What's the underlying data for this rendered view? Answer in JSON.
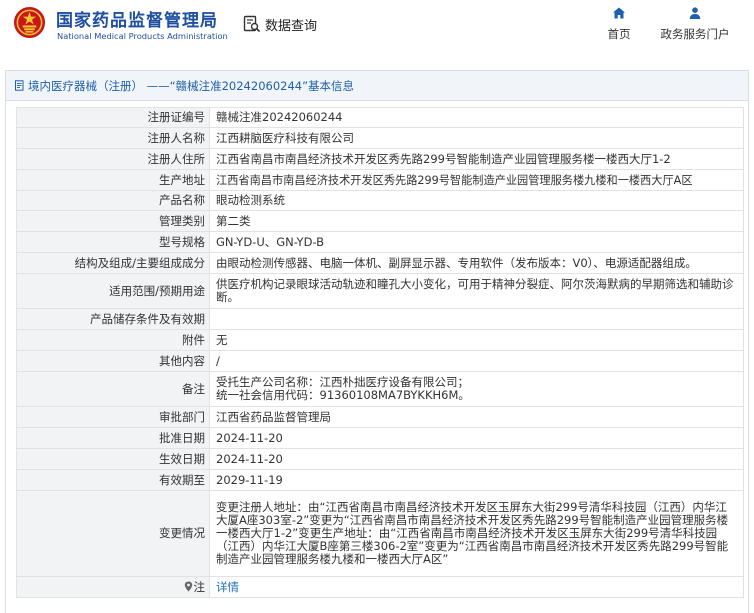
{
  "header": {
    "logo_cn": "国家药品监督管理局",
    "logo_en": "National Medical Products Administration",
    "search_label": "数据查询",
    "nav": [
      {
        "label": "首页",
        "icon": "home-icon"
      },
      {
        "label": "政务服务门户",
        "icon": "user-icon"
      }
    ]
  },
  "panel": {
    "title": "境内医疗器械（注册） ——“赣械注准20242060244”基本信息"
  },
  "rows": [
    {
      "label": "注册证编号",
      "value": "赣械注准20242060244"
    },
    {
      "label": "注册人名称",
      "value": "江西耕脑医疗科技有限公司"
    },
    {
      "label": "注册人住所",
      "value": "江西省南昌市南昌经济技术开发区秀先路299号智能制造产业园管理服务楼一楼西大厅1-2"
    },
    {
      "label": "生产地址",
      "value": "江西省南昌市南昌经济技术开发区秀先路299号智能制造产业园管理服务楼九楼和一楼西大厅A区"
    },
    {
      "label": "产品名称",
      "value": "眼动检测系统"
    },
    {
      "label": "管理类别",
      "value": "第二类"
    },
    {
      "label": "型号规格",
      "value": "GN-YD-U、GN-YD-B"
    },
    {
      "label": "结构及组成/主要组成成分",
      "value": "由眼动检测传感器、电脑一体机、副屏显示器、专用软件（发布版本：V0）、电源适配器组成。"
    },
    {
      "label": "适用范围/预期用途",
      "value": "供医疗机构记录眼球活动轨迹和瞳孔大小变化，可用于精神分裂症、阿尔茨海默病的早期筛选和辅助诊断。"
    },
    {
      "label": "产品储存条件及有效期",
      "value": ""
    },
    {
      "label": "附件",
      "value": "无"
    },
    {
      "label": "其他内容",
      "value": "/"
    },
    {
      "label": "备注",
      "value_lines": [
        "受托生产公司名称：江西朴拙医疗设备有限公司；",
        "统一社会信用代码：91360108MA7BYKKH6M。"
      ]
    },
    {
      "label": "审批部门",
      "value": "江西省药品监督管理局"
    },
    {
      "label": "批准日期",
      "value": "2024-11-20"
    },
    {
      "label": "生效日期",
      "value": "2024-11-20"
    },
    {
      "label": "有效期至",
      "value": "2029-11-19"
    },
    {
      "label": "变更情况",
      "value": "变更注册人地址：由“江西省南昌市南昌经济技术开发区玉屏东大街299号清华科技园（江西）内华江大厦A座303室-2”变更为“江西省南昌市南昌经济技术开发区秀先路299号智能制造产业园管理服务楼一楼西大厅1-2”变更生产地址：由“江西省南昌市南昌经济技术开发区玉屏东大街299号清华科技园（江西）内华江大厦B座第三楼306-2室”变更为“江西省南昌市南昌经济技术开发区秀先路299号智能制造产业园管理服务楼九楼和一楼西大厅A区”"
    },
    {
      "label": "注",
      "value": "详情",
      "icon": "map-pin-icon"
    }
  ]
}
